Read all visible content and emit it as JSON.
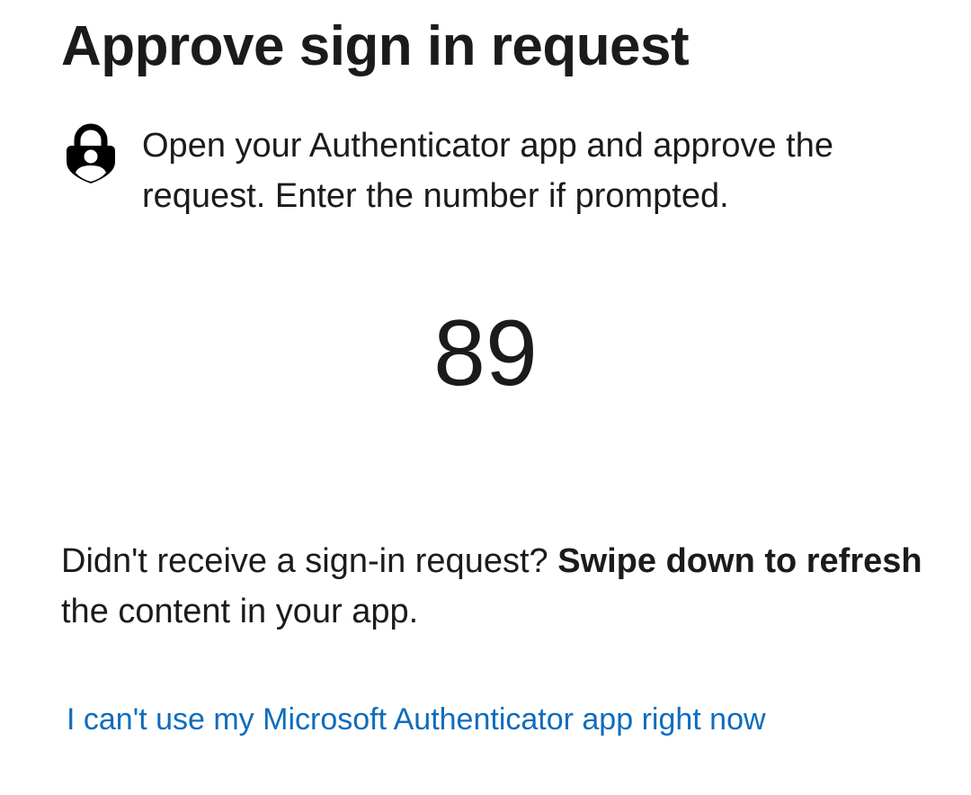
{
  "page": {
    "title": "Approve sign in request"
  },
  "instruction": {
    "icon": "authenticator-lock-icon",
    "text": "Open your Authenticator app and approve the request. Enter the number if prompted."
  },
  "number_match": {
    "value": "89"
  },
  "help": {
    "prefix": "Didn't receive a sign-in request? ",
    "bold": "Swipe down to refresh",
    "suffix": " the content in your app."
  },
  "alternative": {
    "link_label": "I can't use my Microsoft Authenticator app right now"
  },
  "colors": {
    "text": "#1b1b1b",
    "link": "#0f6cbd",
    "background": "#ffffff"
  }
}
